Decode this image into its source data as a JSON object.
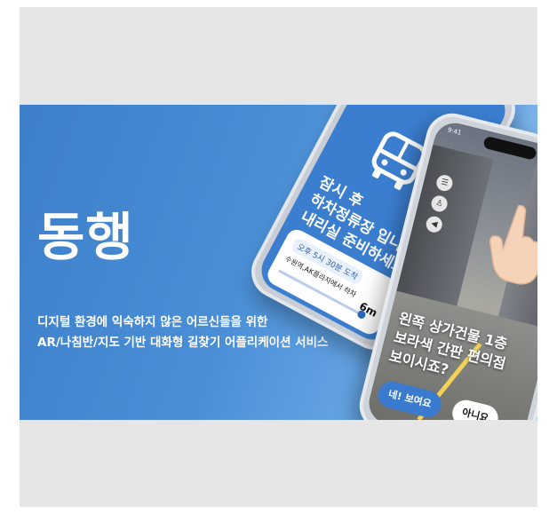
{
  "banner": {
    "logo": "동행",
    "tagline_line1": "디지털 환경에 익숙하지 않은 어르신들을 위한",
    "tagline_line2": "AR/나침반/지도 기반 대화형 길찾기 어플리케이션 서비스"
  },
  "phone_bus": {
    "icon": "bus-icon",
    "message_line1": "잠시 후",
    "message_line2": "하차정류장 입니다.",
    "message_line3": "내리실 준비하세요!",
    "eta": "오후 5시 30분 도착",
    "stop": "수원역,AK플라자에서 하차",
    "distance": "6m"
  },
  "phone_ar": {
    "time": "9:41",
    "question_line1": "왼쪽 상가건물 1층",
    "question_line2": "보라색 간판 편의점",
    "question_line3": "보이시죠?",
    "yes_label": "네! 보여요",
    "no_label": "아니요",
    "controls": [
      "menu-icon",
      "walk-icon",
      "sound-icon"
    ]
  },
  "colors": {
    "background": "#e6e6e6",
    "banner_blue": "#3d7fcb",
    "accent": "#3a7bd0"
  }
}
